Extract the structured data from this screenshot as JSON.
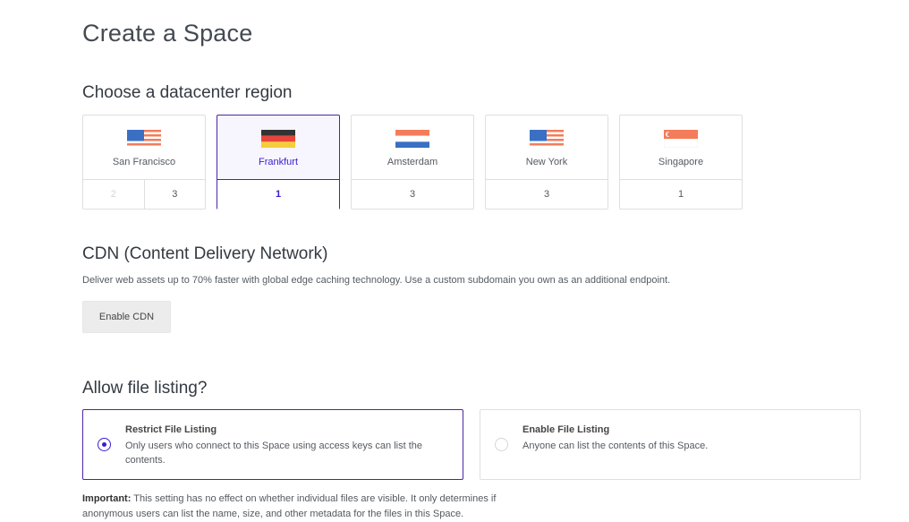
{
  "page": {
    "title": "Create a Space"
  },
  "region_section": {
    "title": "Choose a datacenter region",
    "regions": [
      {
        "name": "San Francisco",
        "flag": "us-flag",
        "datacenters": [
          {
            "label": "2",
            "disabled": true
          },
          {
            "label": "3",
            "disabled": false
          }
        ],
        "selected": false
      },
      {
        "name": "Frankfurt",
        "flag": "de-flag",
        "datacenters": [
          {
            "label": "1",
            "disabled": false
          }
        ],
        "selected": true
      },
      {
        "name": "Amsterdam",
        "flag": "nl-flag",
        "datacenters": [
          {
            "label": "3",
            "disabled": false
          }
        ],
        "selected": false
      },
      {
        "name": "New York",
        "flag": "us-flag",
        "datacenters": [
          {
            "label": "3",
            "disabled": false
          }
        ],
        "selected": false
      },
      {
        "name": "Singapore",
        "flag": "sg-flag",
        "datacenters": [
          {
            "label": "1",
            "disabled": false
          }
        ],
        "selected": false
      }
    ]
  },
  "cdn": {
    "title": "CDN (Content Delivery Network)",
    "description": "Deliver web assets up to 70% faster with global edge caching technology. Use a custom subdomain you own as an additional endpoint.",
    "button_label": "Enable CDN"
  },
  "file_listing": {
    "title": "Allow file listing?",
    "options": [
      {
        "title": "Restrict File Listing",
        "description": "Only users who connect to this Space using access keys can list the contents.",
        "selected": true
      },
      {
        "title": "Enable File Listing",
        "description": "Anyone can list the contents of this Space.",
        "selected": false
      }
    ],
    "note_label": "Important:",
    "note_text": " This setting has no effect on whether individual files are visible. It only determines if anonymous users can list the name, size, and other metadata for the files in this Space."
  },
  "colors": {
    "accent": "#3c1bd1",
    "selected_border": "#4d24a6",
    "button_bg": "#ececec",
    "border": "#dfdfdf"
  }
}
